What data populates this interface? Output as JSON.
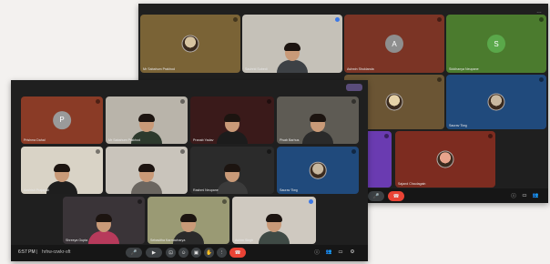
{
  "back_screen": {
    "tiles": [
      {
        "name": "Mr Sabahum Prakhod",
        "bg": "#7a6336",
        "kind": "avatar",
        "avatar_color": "#d6c3a0"
      },
      {
        "name": "Sauhrid Subedi",
        "bg": "#c5c1b8",
        "kind": "person",
        "shirt": "#3d4145"
      },
      {
        "name": "Ashwin Shuklanda",
        "bg": "#7b3425",
        "kind": "letter",
        "letter": "A",
        "letter_bg": "#8e8e8e"
      },
      {
        "name": "Siddhanya Neupane",
        "bg": "#4b7b2e",
        "kind": "letter",
        "letter": "S",
        "letter_bg": "#5aa84a"
      },
      {
        "name": "",
        "bg": "#6b5534",
        "kind": "avatar",
        "avatar_color": "#e6d2a8"
      },
      {
        "name": "Saurav Tiwg",
        "bg": "#204a7c",
        "kind": "avatar",
        "avatar_color": "#c8b8a0"
      },
      {
        "name": "",
        "bg": "#6a3bb1",
        "kind": "blank"
      },
      {
        "name": "Sajand Chaulagain",
        "bg": "#7d2c20",
        "kind": "avatar",
        "avatar_color": "#e9a48c"
      }
    ],
    "controls": [
      "mic-icon",
      "end-call-icon",
      "info-icon",
      "chat-icon",
      "people-icon"
    ],
    "ctrl_glyphs": [
      "🎤",
      "☎",
      "ⓘ",
      "▭",
      "👥"
    ]
  },
  "front_screen": {
    "time": "6:57 PM",
    "meeting_code": "hrhw-rzwkr-sft",
    "tiles": [
      {
        "name": "Prishma Dahal",
        "bg": "#8a3b26",
        "kind": "letter",
        "letter": "P",
        "letter_bg": "#9a9a9a"
      },
      {
        "name": "Mr Sabahum Prakhod",
        "bg": "#b9b4aa",
        "kind": "person",
        "shirt": "#2d3a2d"
      },
      {
        "name": "Pranab Yadav",
        "bg": "#3a1a1a",
        "kind": "person",
        "shirt": "#1c1c1c"
      },
      {
        "name": "Pisab Barhus",
        "bg": "#5e5b54",
        "kind": "person",
        "shirt": "#2a2a2a"
      },
      {
        "name": "Aashish Prajapati",
        "bg": "#d9d3c6",
        "kind": "person",
        "shirt": "#1e1e1e"
      },
      {
        "name": "",
        "bg": "#c9c4bb",
        "kind": "person",
        "shirt": "#6b6660"
      },
      {
        "name": "Rashmi Neupane",
        "bg": "#2b2b2b",
        "kind": "person",
        "shirt": "#3b3b3b"
      },
      {
        "name": "Saurav Tiwg",
        "bg": "#204a7c",
        "kind": "avatar",
        "avatar_color": "#c8b8a0"
      },
      {
        "name": "Shreeya Gupta",
        "bg": "#3a3438",
        "kind": "person",
        "shirt": "#b73a5b"
      },
      {
        "name": "Sebasitha Karmacharya",
        "bg": "#9a9a74",
        "kind": "person",
        "shirt": "#2a2a2a"
      },
      {
        "name": "Ashim Singh",
        "bg": "#cfc9c0",
        "kind": "person",
        "shirt": "#3f4a45"
      }
    ],
    "controls": [
      "mic-icon",
      "camera-icon",
      "captions-icon",
      "emoji-icon",
      "present-icon",
      "raise-hand-icon",
      "more-icon",
      "end-call-icon"
    ],
    "ctrl_glyphs": [
      "🎤",
      "▶",
      "⊡",
      "☺",
      "▣",
      "✋",
      "⋮",
      "☎"
    ],
    "side_controls": [
      "info-icon",
      "people-icon",
      "chat-icon",
      "activities-icon"
    ],
    "side_glyphs": [
      "ⓘ",
      "👥",
      "▭",
      "⚙"
    ]
  }
}
